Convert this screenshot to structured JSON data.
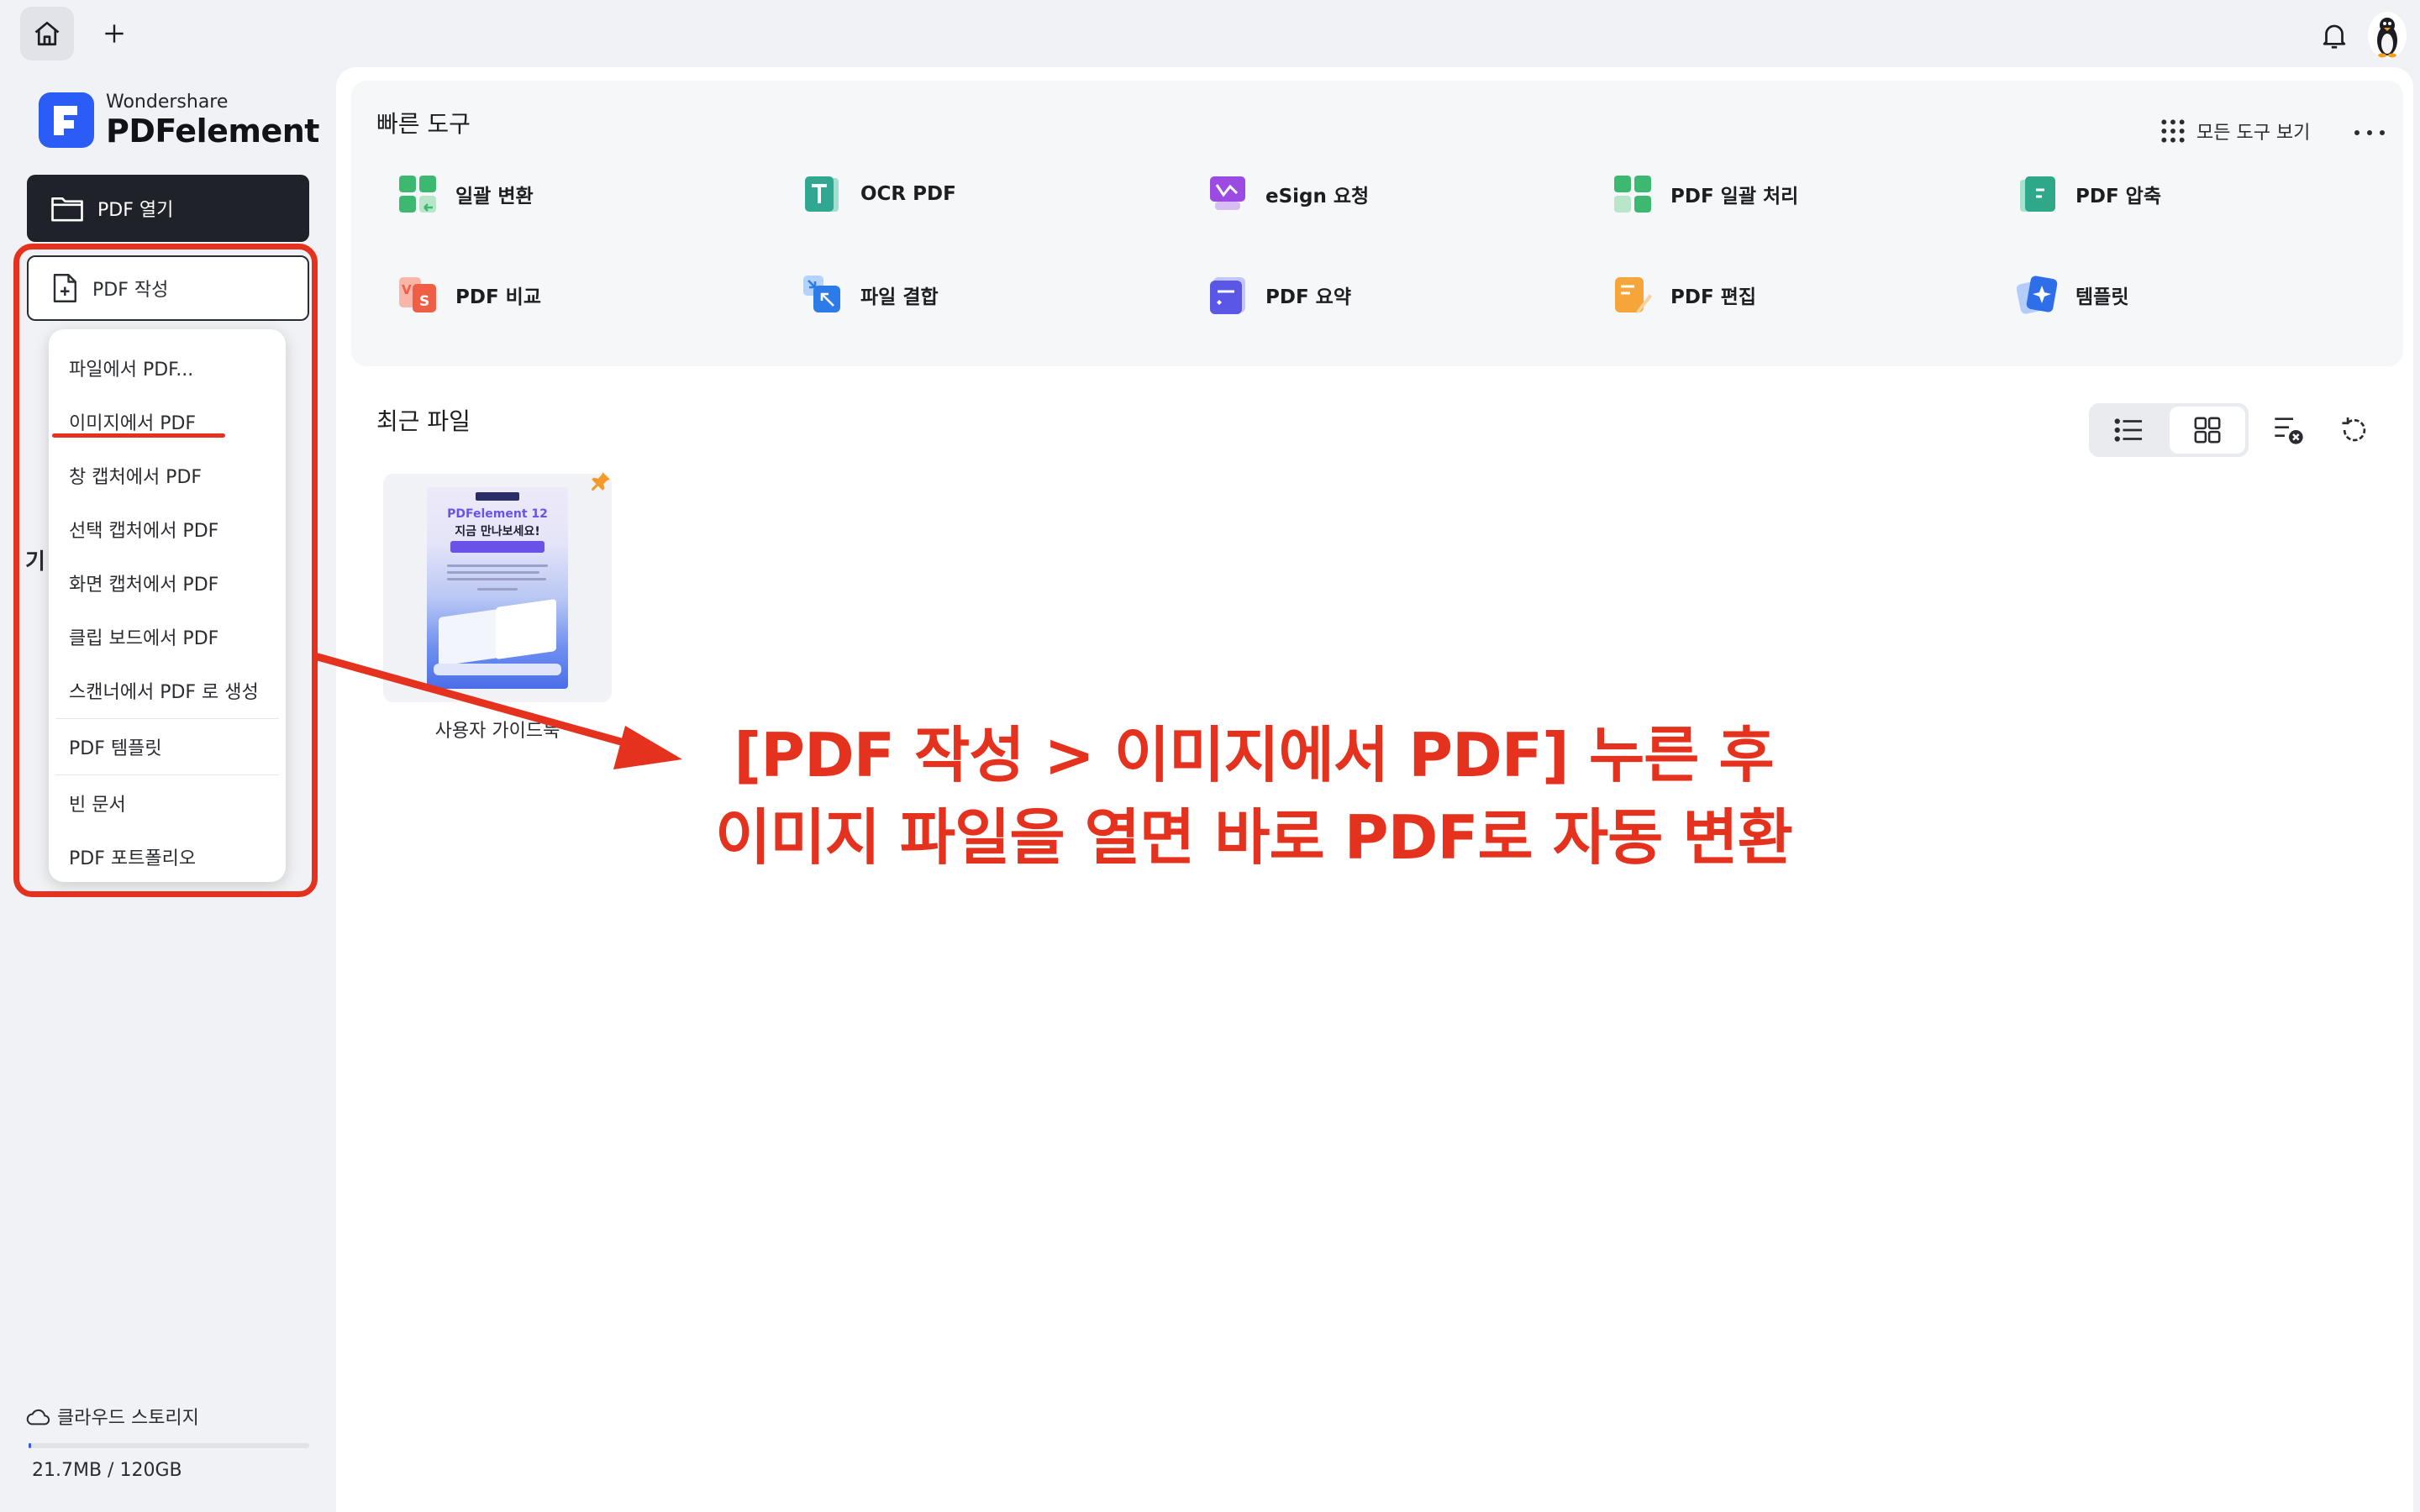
{
  "topbar": {
    "icons": {
      "home": "home-icon",
      "add": "plus-icon",
      "notify": "bell-icon",
      "avatar": "penguin-avatar"
    }
  },
  "sidebar": {
    "logo_brand": "Wondershare",
    "logo_product": "PDFelement",
    "open_label": "PDF 열기",
    "create_label": "PDF 작성",
    "create_menu": [
      "파일에서 PDF...",
      "이미지에서 PDF",
      "창 캡처에서 PDF",
      "선택 캡처에서 PDF",
      "화면 캡처에서 PDF",
      "클립 보드에서 PDF",
      "스캔너에서 PDF 로 생성",
      "PDF 템플릿",
      "빈 문서",
      "PDF 포트폴리오"
    ],
    "peek_label": "기",
    "storage_label": "클라우드 스토리지",
    "storage_usage": "21.7MB / 120GB",
    "storage_fraction": 0.0002
  },
  "quick_tools": {
    "title": "빠른 도구",
    "view_all": "모든 도구 보기",
    "tools": [
      {
        "label": "일괄 변환",
        "icon": "batch-convert-icon"
      },
      {
        "label": "OCR PDF",
        "icon": "ocr-icon"
      },
      {
        "label": "eSign 요청",
        "icon": "esign-icon"
      },
      {
        "label": "PDF 일괄 처리",
        "icon": "batch-process-icon"
      },
      {
        "label": "PDF 압축",
        "icon": "compress-icon"
      },
      {
        "label": "PDF 비교",
        "icon": "compare-icon"
      },
      {
        "label": "파일 결합",
        "icon": "combine-icon"
      },
      {
        "label": "PDF 요약",
        "icon": "summarize-icon"
      },
      {
        "label": "PDF 편집",
        "icon": "edit-icon"
      },
      {
        "label": "템플릿",
        "icon": "template-icon"
      }
    ]
  },
  "recent": {
    "title": "최근 파일",
    "files": [
      {
        "name": "사용자 가이드북",
        "thumb_brand": "PDFelement 12",
        "thumb_title": "지금 만나보세요!"
      }
    ]
  },
  "annotation": {
    "line1": "[PDF 작성 > 이미지에서 PDF] 누른 후",
    "line2": "이미지 파일을 열면 바로 PDF로 자동 변환",
    "color": "#e4321e"
  },
  "colors": {
    "accent": "#2c5cf6",
    "annotation": "#e4321e",
    "dark_button": "#1f2228"
  }
}
